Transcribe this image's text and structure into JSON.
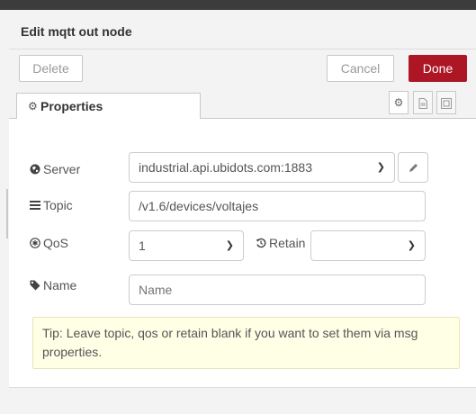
{
  "dialog": {
    "title": "Edit mqtt out node"
  },
  "actions": {
    "delete_label": "Delete",
    "cancel_label": "Cancel",
    "done_label": "Done"
  },
  "tabs": {
    "properties_label": "Properties"
  },
  "form": {
    "server": {
      "label": "Server",
      "value": "industrial.api.ubidots.com:1883"
    },
    "topic": {
      "label": "Topic",
      "value": "/v1.6/devices/voltajes"
    },
    "qos": {
      "label": "QoS",
      "value": "1"
    },
    "retain": {
      "label": "Retain",
      "value": ""
    },
    "name": {
      "label": "Name",
      "value": "",
      "placeholder": "Name"
    }
  },
  "tip": {
    "text": "Tip: Leave topic, qos or retain blank if you want to set them via msg properties."
  },
  "colors": {
    "accent": "#ad1625",
    "tip_bg": "#ffffe6"
  }
}
